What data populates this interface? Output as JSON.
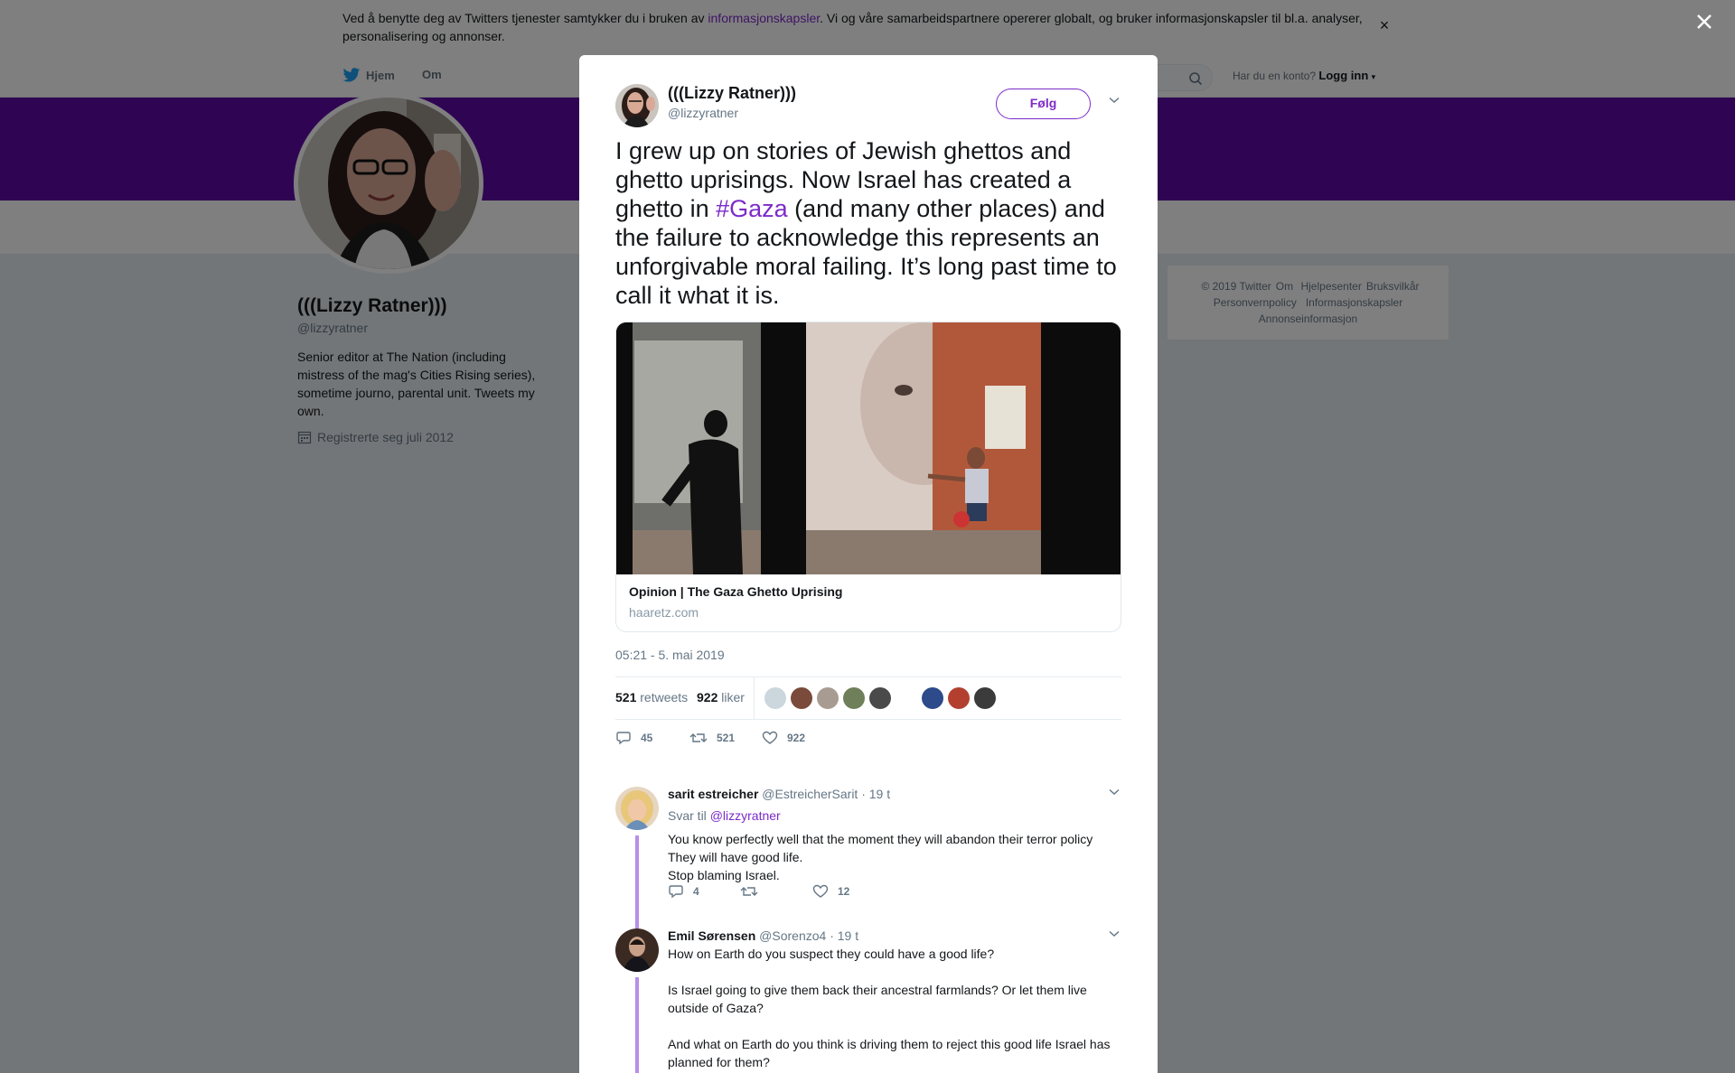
{
  "cookie_bar": {
    "text_before": "Ved å benytte deg av Twitters tjenester samtykker du i bruken av ",
    "link": "informasjonskapsler",
    "text_after": ". Vi og våre samarbeidspartnere opererer globalt, og bruker informasjonskapsler til bl.a. analyser, personalisering og annonser.",
    "close": "×"
  },
  "nav": {
    "home": "Hjem",
    "about": "Om",
    "account_prompt": "Har du en konto?",
    "login": "Logg inn"
  },
  "profile": {
    "name": "(((Lizzy Ratner)))",
    "handle": "@lizzyratner",
    "bio": "Senior editor at The Nation (including mistress of the mag's Cities Rising series), sometime journo, parental unit. Tweets my own.",
    "joined": "Registrerte seg juli 2012"
  },
  "footer": {
    "links": [
      "© 2019 Twitter",
      "Om",
      "Hjelpesenter",
      "Bruksvilkår",
      "Personvernpolicy",
      "Informasjonskapsler",
      "Annonseinformasjon"
    ]
  },
  "tweet": {
    "name": "(((Lizzy Ratner)))",
    "handle": "@lizzyratner",
    "follow_label": "Følg",
    "text_before": "I grew up on stories of Jewish ghettos and ghetto uprisings. Now Israel has created a ghetto in ",
    "hashtag": "#Gaza",
    "text_after": " (and many other places) and the failure to acknowledge this represents an unforgivable moral failing. It’s long past time to call it what it is.",
    "card_title": "Opinion | The Gaza Ghetto Uprising",
    "card_domain": "haaretz.com",
    "timestamp": "05:21 - 5. mai 2019",
    "retweets_count": "521",
    "retweets_label": "retweets",
    "likes_count": "922",
    "likes_label": "liker",
    "actions": {
      "replies": "45",
      "retweets": "521",
      "likes": "922"
    }
  },
  "replies": [
    {
      "name": "sarit estreicher",
      "handle": "@EstreicherSarit",
      "time": "· 19 t",
      "reply_to_label": "Svar til",
      "reply_to": "@lizzyratner",
      "text": "You know perfectly  well that the moment they will abandon  their terror   policy They will have good life.\nStop blaming Israel.",
      "replies": "4",
      "retweets": "",
      "likes": "12"
    },
    {
      "name": "Emil Sørensen",
      "handle": "@Sorenzo4",
      "time": "· 19 t",
      "text": "How on Earth do you suspect they could have a good life?\n\nIs Israel going to give them back their ancestral farmlands? Or let them live outside of Gaza?\n\nAnd what on Earth do you think is driving them to reject this good life Israel has planned for them?"
    }
  ],
  "colors": {
    "accent": "#7c2bc9",
    "banner": "#5e0aa6",
    "thread_line": "#b88ee6"
  }
}
